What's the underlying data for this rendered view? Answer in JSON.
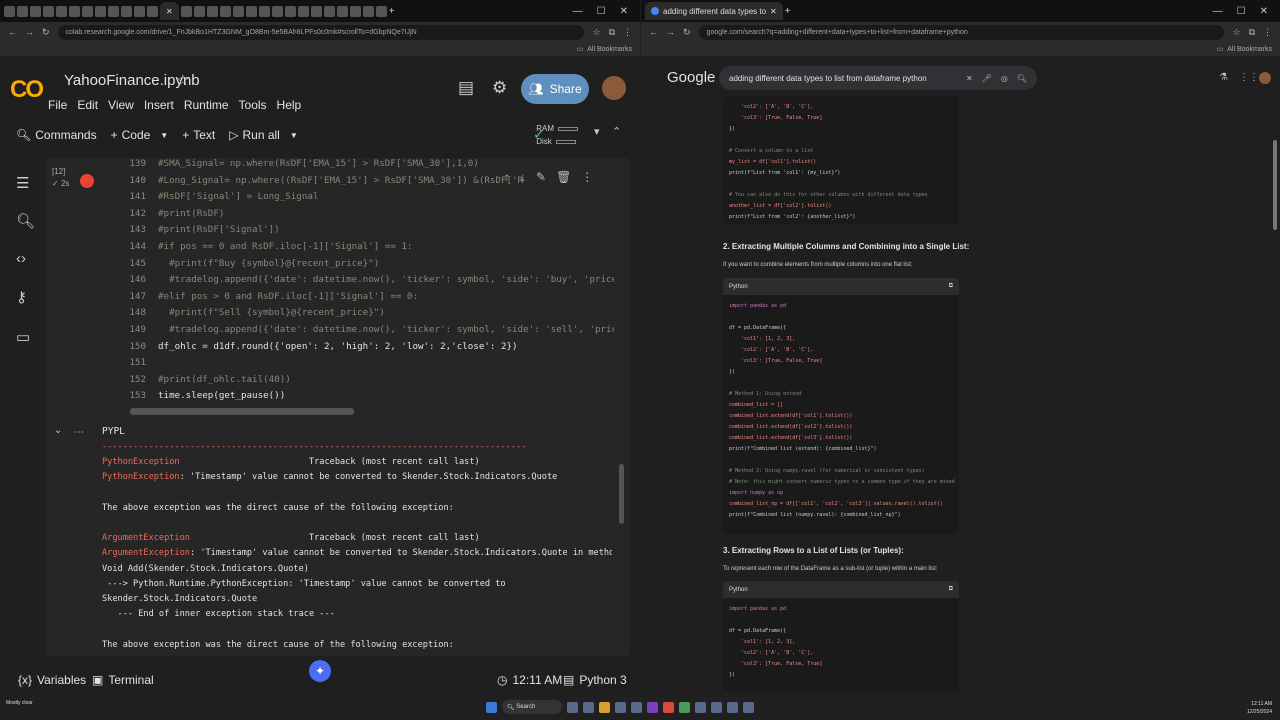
{
  "left_browser": {
    "tab_title": "",
    "address": "colab.research.google.com/drive/1_FnJbkBo1HTZ3GNM_gO8Bm-5e5BAh8LPFs0c0mk#scrollTo=dGbpNQe7IJjN",
    "bookmarks_label": "All Bookmarks"
  },
  "colab": {
    "logo": "CO",
    "title": "YahooFinance.ipynb",
    "menu": [
      "File",
      "Edit",
      "View",
      "Insert",
      "Runtime",
      "Tools",
      "Help"
    ],
    "share_label": "Share",
    "toolbar": {
      "commands": "Commands",
      "code": "Code",
      "text": "Text",
      "run_all": "Run all"
    },
    "ram_label": "RAM",
    "disk_label": "Disk",
    "cell": {
      "exec_count": "[12]",
      "exec_time": "2s",
      "lines": [
        {
          "n": "139",
          "t": "#SMA_Signal= np.where(RsDF['EMA_15'] > RsDF['SMA_30'],1,0)",
          "c": true
        },
        {
          "n": "140",
          "t": "#Long_Signal= np.where((RsDF['EMA_15'] > RsDF['SMA_30']) &(RsDF['R",
          "c": true
        },
        {
          "n": "141",
          "t": "#RsDF['Signal'] = Long_Signal",
          "c": true
        },
        {
          "n": "142",
          "t": "#print(RsDF)",
          "c": true
        },
        {
          "n": "143",
          "t": "#print(RsDF['Signal'])",
          "c": true
        },
        {
          "n": "144",
          "t": "#if pos == 0 and RsDF.iloc[-1]['Signal'] == 1:",
          "c": true
        },
        {
          "n": "145",
          "t": "  #print(f\"Buy {symbol}@{recent_price}\")",
          "c": true
        },
        {
          "n": "146",
          "t": "  #tradelog.append({'date': datetime.now(), 'ticker': symbol, 'side': 'buy', 'price': re",
          "c": true
        },
        {
          "n": "147",
          "t": "#elif pos > 0 and RsDF.iloc[-1]['Signal'] == 0:",
          "c": true
        },
        {
          "n": "148",
          "t": "  #print(f\"Sell {symbol}@{recent_price}\")",
          "c": true
        },
        {
          "n": "149",
          "t": "  #tradelog.append({'date': datetime.now(), 'ticker': symbol, 'side': 'sell', 'price': r",
          "c": true
        },
        {
          "n": "150",
          "t": "df_ohlc = d1df.round({'open': 2, 'high': 2, 'low': 2,'close': 2})",
          "c": false
        },
        {
          "n": "151",
          "t": "",
          "c": false
        },
        {
          "n": "152",
          "t": "#print(df_ohlc.tail(40))",
          "c": true
        },
        {
          "n": "153",
          "t": "time.sleep(get_pause())",
          "c": false
        }
      ]
    },
    "output": {
      "header": "PYPL",
      "lines": [
        {
          "t": "----------------------------------------------------------------------------------",
          "e": false
        },
        {
          "t": "PythonException                         Traceback (most recent call last)",
          "e": "PythonException"
        },
        {
          "t": "PythonException: 'Timestamp' value cannot be converted to Skender.Stock.Indicators.Quote",
          "e": "PythonException"
        },
        {
          "t": "",
          "e": false
        },
        {
          "t": "The above exception was the direct cause of the following exception:",
          "e": false
        },
        {
          "t": "",
          "e": false
        },
        {
          "t": "ArgumentException                       Traceback (most recent call last)",
          "e": "ArgumentException"
        },
        {
          "t": "ArgumentException: 'Timestamp' value cannot be converted to Skender.Stock.Indicators.Quote in method",
          "e": "ArgumentException"
        },
        {
          "t": "Void Add(Skender.Stock.Indicators.Quote)",
          "e": false
        },
        {
          "t": " ---> Python.Runtime.PythonException: 'Timestamp' value cannot be converted to",
          "e": false
        },
        {
          "t": "Skender.Stock.Indicators.Quote",
          "e": false
        },
        {
          "t": "   --- End of inner exception stack trace ---",
          "e": false
        },
        {
          "t": "",
          "e": false
        },
        {
          "t": "The above exception was the direct cause of the following exception:",
          "e": false
        }
      ]
    },
    "status": {
      "variables": "Variables",
      "terminal": "Terminal",
      "time": "12:11 AM",
      "runtime": "Python 3"
    }
  },
  "right_browser": {
    "tab_title": "adding different data types to",
    "address": "google.com/search?q=adding+different+data+types+to+list+from+dataframe+python",
    "google_logo": "Google",
    "query": "adding different data types to list from dataframe python",
    "sections": [
      {
        "heading": "2. Extracting Multiple Columns and Combining into a Single List:",
        "para": "If you want to combine elements from multiple columns into one flat list:"
      },
      {
        "heading": "3. Extracting Rows to a List of Lists (or Tuples):",
        "para": "To represent each row of the DataFrame as a sub-list (or tuple) within a main list:"
      }
    ],
    "code_lang": "Python"
  },
  "taskbar": {
    "weather": "Mostly clear",
    "search": "Search",
    "clock_time": "12:11 AM",
    "clock_date": "12/25/2024"
  }
}
